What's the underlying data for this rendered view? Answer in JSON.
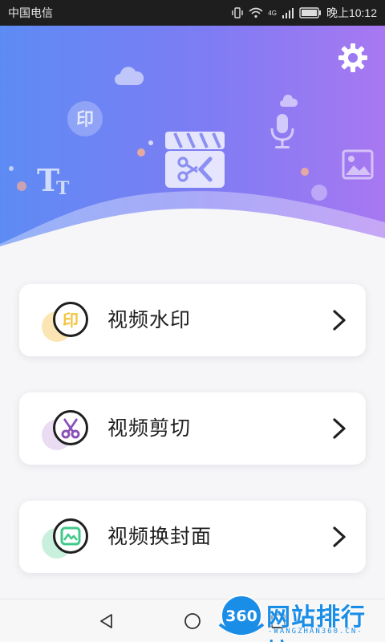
{
  "status_bar": {
    "carrier": "中国电信",
    "network": "4G",
    "time": "晚上10:12"
  },
  "hero": {
    "settings_icon": "gear-icon",
    "center_icon": "video-clip-icon",
    "decorations": [
      "cloud-icon",
      "stamp-print-icon",
      "text-size-icon",
      "microphone-icon",
      "image-icon"
    ]
  },
  "menu": [
    {
      "label": "视频水印",
      "icon": "stamp-print-icon",
      "icon_text": "印",
      "accent": "#f4c542",
      "blob": "#fbe6b3"
    },
    {
      "label": "视频剪切",
      "icon": "scissors-icon",
      "accent": "#8a52b8",
      "blob": "#eadcf2"
    },
    {
      "label": "视频换封面",
      "icon": "image-cover-icon",
      "accent": "#41c98a",
      "blob": "#c9f0dc"
    }
  ],
  "nav_bar": {
    "buttons": [
      "back-icon",
      "home-icon",
      "recents-icon"
    ]
  },
  "watermark": {
    "logo_text": "360",
    "title": "网站排行榜",
    "subtitle": "-WANGZHAN360.CN-"
  },
  "colors": {
    "hero_start": "#5d8bf4",
    "hero_end": "#a878f2",
    "card_bg": "#ffffff",
    "page_bg": "#f6f6f8",
    "watermark_blue": "#1a8de6"
  }
}
